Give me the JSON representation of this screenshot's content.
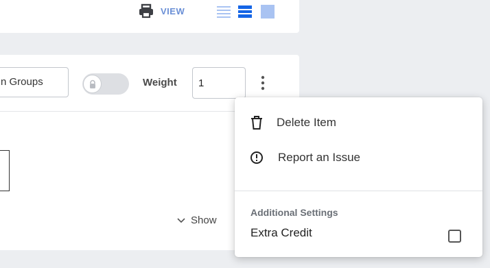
{
  "toolbar": {
    "view_label": "VIEW",
    "print_icon": "printer-icon",
    "view_modes": [
      "list-view-icon",
      "bold-list-view-icon",
      "grid-view-icon"
    ],
    "accent_color": "#1565e6"
  },
  "question_header": {
    "groups_value": "n Groups",
    "lock_toggle_icon": "lock-icon",
    "weight_label": "Weight",
    "weight_value": "1",
    "more_icon": "vertical-dots-icon"
  },
  "question_body": {
    "show_label": "Show"
  },
  "context_menu": {
    "items": [
      {
        "icon": "trash-icon",
        "label": "Delete Item"
      },
      {
        "icon": "exclamation-circle-icon",
        "label": "Report an Issue"
      }
    ],
    "settings_heading": "Additional Settings",
    "extra_credit_label": "Extra Credit",
    "extra_credit_checked": false
  }
}
